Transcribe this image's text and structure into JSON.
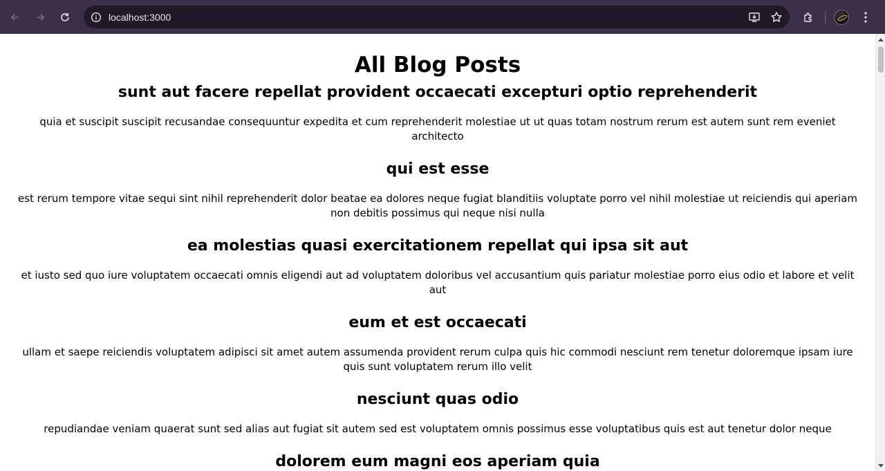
{
  "browser": {
    "url": "localhost:3000"
  },
  "page": {
    "title": "All Blog Posts",
    "posts": [
      {
        "title": "sunt aut facere repellat provident occaecati excepturi optio reprehenderit",
        "body": "quia et suscipit suscipit recusandae consequuntur expedita et cum reprehenderit molestiae ut ut quas totam nostrum rerum est autem sunt rem eveniet architecto"
      },
      {
        "title": "qui est esse",
        "body": "est rerum tempore vitae sequi sint nihil reprehenderit dolor beatae ea dolores neque fugiat blanditiis voluptate porro vel nihil molestiae ut reiciendis qui aperiam non debitis possimus qui neque nisi nulla"
      },
      {
        "title": "ea molestias quasi exercitationem repellat qui ipsa sit aut",
        "body": "et iusto sed quo iure voluptatem occaecati omnis eligendi aut ad voluptatem doloribus vel accusantium quis pariatur molestiae porro eius odio et labore et velit aut"
      },
      {
        "title": "eum et est occaecati",
        "body": "ullam et saepe reiciendis voluptatem adipisci sit amet autem assumenda provident rerum culpa quis hic commodi nesciunt rem tenetur doloremque ipsam iure quis sunt voluptatem rerum illo velit"
      },
      {
        "title": "nesciunt quas odio",
        "body": "repudiandae veniam quaerat sunt sed alias aut fugiat sit autem sed est voluptatem omnis possimus esse voluptatibus quis est aut tenetur dolor neque"
      },
      {
        "title": "dolorem eum magni eos aperiam quia",
        "body": ""
      }
    ]
  }
}
